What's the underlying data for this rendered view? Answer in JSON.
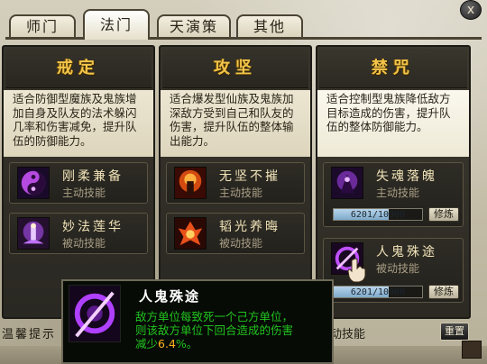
{
  "window": {
    "close_label": "x"
  },
  "tabs": [
    {
      "label": "师门",
      "active": false
    },
    {
      "label": "法门",
      "active": true
    },
    {
      "label": "天演策",
      "active": false
    },
    {
      "label": "其他",
      "active": false
    }
  ],
  "columns": [
    {
      "title": "戒定",
      "description": "适合防御型魔族及鬼族增加自身及队友的法术躲闪几率和伤害减免，提升队伍的防御能力。",
      "skills": [
        {
          "name": "刚柔兼备",
          "type": "主动技能",
          "icon": "yin-yang-icon"
        },
        {
          "name": "妙法莲华",
          "type": "被动技能",
          "icon": "lotus-figure-icon"
        }
      ]
    },
    {
      "title": "攻坚",
      "description": "适合爆发型仙族及鬼族加深敌方受到自己和队友的伤害，提升队伍的整体输出能力。",
      "skills": [
        {
          "name": "无坚不摧",
          "type": "主动技能",
          "icon": "fire-warrior-icon"
        },
        {
          "name": "韬光养晦",
          "type": "被动技能",
          "icon": "flame-burst-icon"
        }
      ]
    },
    {
      "title": "禁咒",
      "description": "适合控制型鬼族降低敌方目标造成的伤害，提升队伍的整体防御能力。",
      "skills": [
        {
          "name": "失魂落魄",
          "type": "主动技能",
          "icon": "dark-spirit-icon",
          "progress_text": "6201/10000",
          "progress": 0.6201,
          "train_label": "修炼"
        },
        {
          "name": "人鬼殊途",
          "type": "被动技能",
          "icon": "purple-blade-icon",
          "progress_text": "6201/10000",
          "progress": 0.6201,
          "train_label": "修炼"
        }
      ]
    }
  ],
  "footer": {
    "hint_label": "温馨提示",
    "hint_tail": "动技能",
    "reset_label": "重置"
  },
  "tooltip": {
    "title": "人鬼殊途",
    "desc_line1": "敌方单位每致死一个己方单位，",
    "desc_line2": "则该敌方单位下回合造成的伤害",
    "desc_line3_prefix": "减少",
    "desc_highlight": "6.4",
    "desc_line3_suffix": "%。",
    "icon": "purple-blade-icon"
  },
  "colors": {
    "title_gold": "#f2c44a",
    "tooltip_green": "#22c41f",
    "tooltip_highlight": "#ffb020"
  }
}
